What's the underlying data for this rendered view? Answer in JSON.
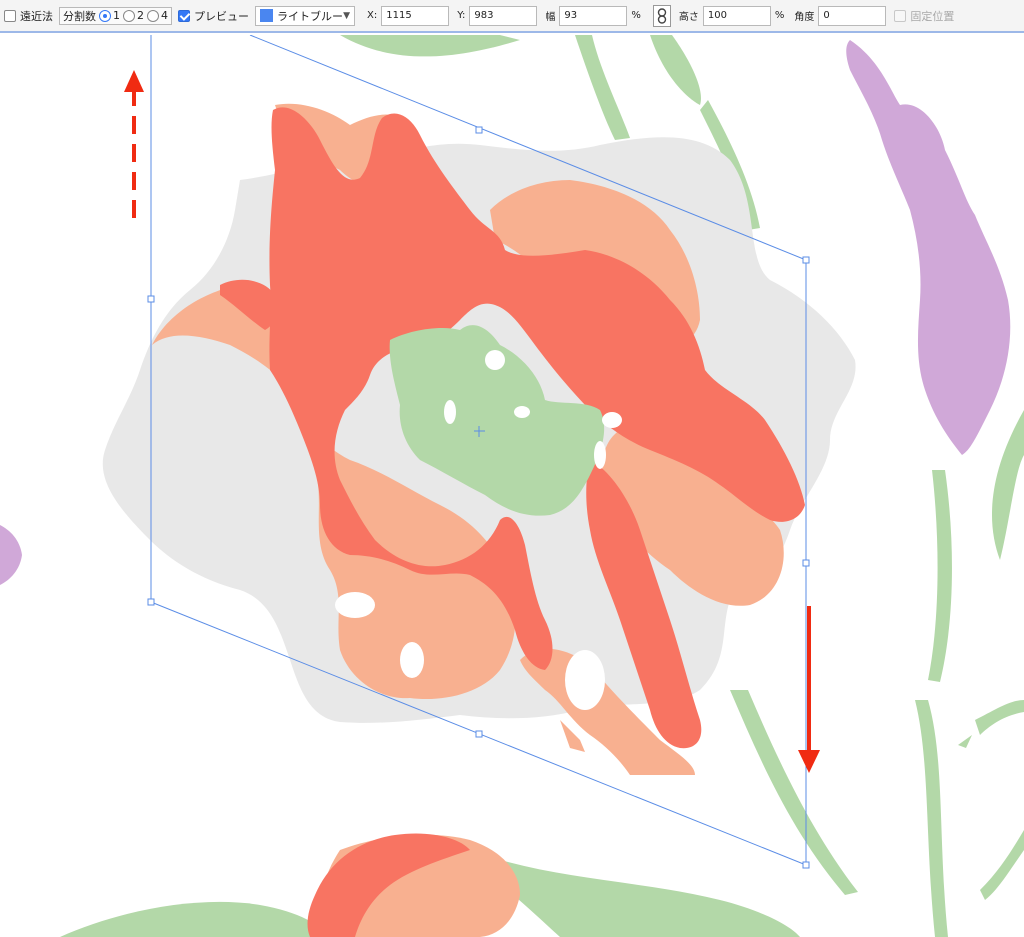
{
  "toolbar": {
    "perspective_label": "遠近法",
    "divisions_label": "分割数",
    "division_options": [
      "1",
      "2",
      "4"
    ],
    "preview_label": "プレビュー",
    "color_select": {
      "value": "ライトブルー",
      "swatch": "#4a86f0"
    },
    "x": {
      "label": "X:",
      "value": "1115"
    },
    "y": {
      "label": "Y:",
      "value": "983"
    },
    "width": {
      "label": "幅",
      "value": "93",
      "unit": "%"
    },
    "height": {
      "label": "高さ",
      "value": "100",
      "unit": "%"
    },
    "angle": {
      "label": "角度",
      "value": "0"
    },
    "fixed_position_label": "固定位置",
    "link_icon": "chain-link-icon"
  },
  "canvas": {
    "background": "#ffffff",
    "colors": {
      "shadow": "#e8e8e8",
      "coral": "#f87462",
      "peach": "#f8b090",
      "green": "#b3d8a8",
      "lilac": "#d0a8d8",
      "frame": "#5b8de6",
      "arrow": "#f02b12"
    }
  }
}
